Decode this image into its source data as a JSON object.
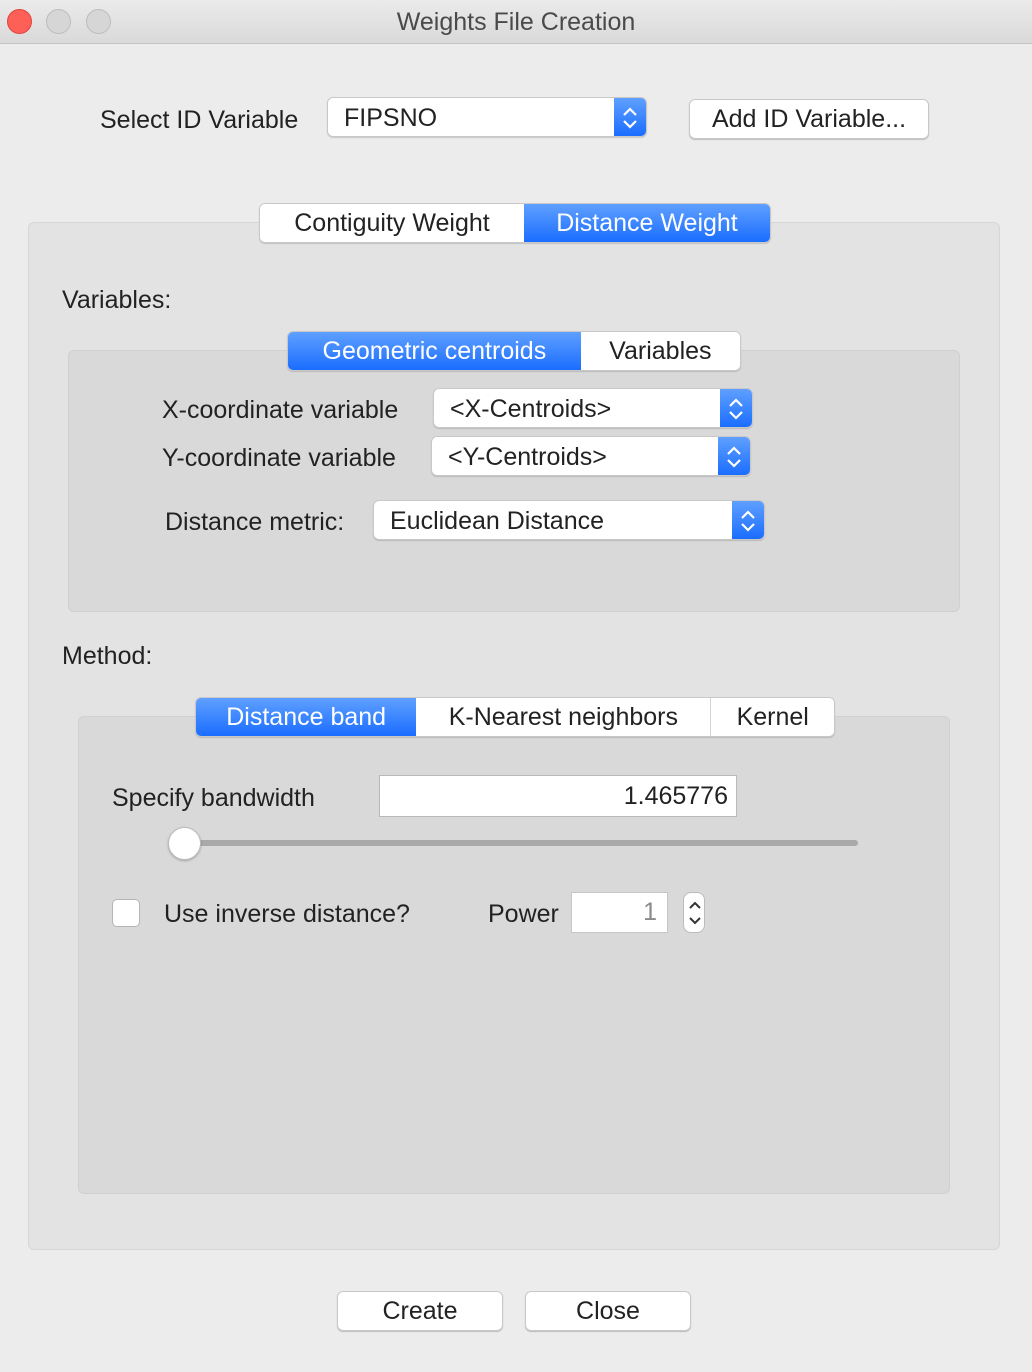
{
  "window": {
    "title": "Weights File Creation",
    "controls": [
      "close",
      "minimize",
      "maximize"
    ]
  },
  "id_variable": {
    "label": "Select ID Variable",
    "selected": "FIPSNO",
    "add_button_label": "Add ID Variable..."
  },
  "weight_tabs": [
    {
      "label": "Contiguity Weight",
      "selected": false
    },
    {
      "label": "Distance Weight",
      "selected": true
    }
  ],
  "variables_section": {
    "heading": "Variables:",
    "tabs": [
      {
        "label": "Geometric centroids",
        "selected": true
      },
      {
        "label": "Variables",
        "selected": false
      }
    ],
    "x_coord": {
      "label": "X-coordinate variable",
      "selected": "<X-Centroids>"
    },
    "y_coord": {
      "label": "Y-coordinate variable",
      "selected": "<Y-Centroids>"
    },
    "distance_metric": {
      "label": "Distance metric:",
      "selected": "Euclidean Distance"
    }
  },
  "method_section": {
    "heading": "Method:",
    "tabs": [
      {
        "label": "Distance band",
        "selected": true
      },
      {
        "label": "K-Nearest neighbors",
        "selected": false
      },
      {
        "label": "Kernel",
        "selected": false
      }
    ],
    "bandwidth": {
      "label": "Specify bandwidth",
      "value": "1.465776",
      "slider_fraction": 0.0
    },
    "inverse_distance": {
      "label": "Use inverse distance?",
      "checked": false
    },
    "power": {
      "label": "Power",
      "value": "1"
    }
  },
  "footer": {
    "create_label": "Create",
    "close_label": "Close"
  },
  "colors": {
    "accent": "#1a6dff",
    "window_bg": "#ececec",
    "close_button": "#fe5f57"
  }
}
